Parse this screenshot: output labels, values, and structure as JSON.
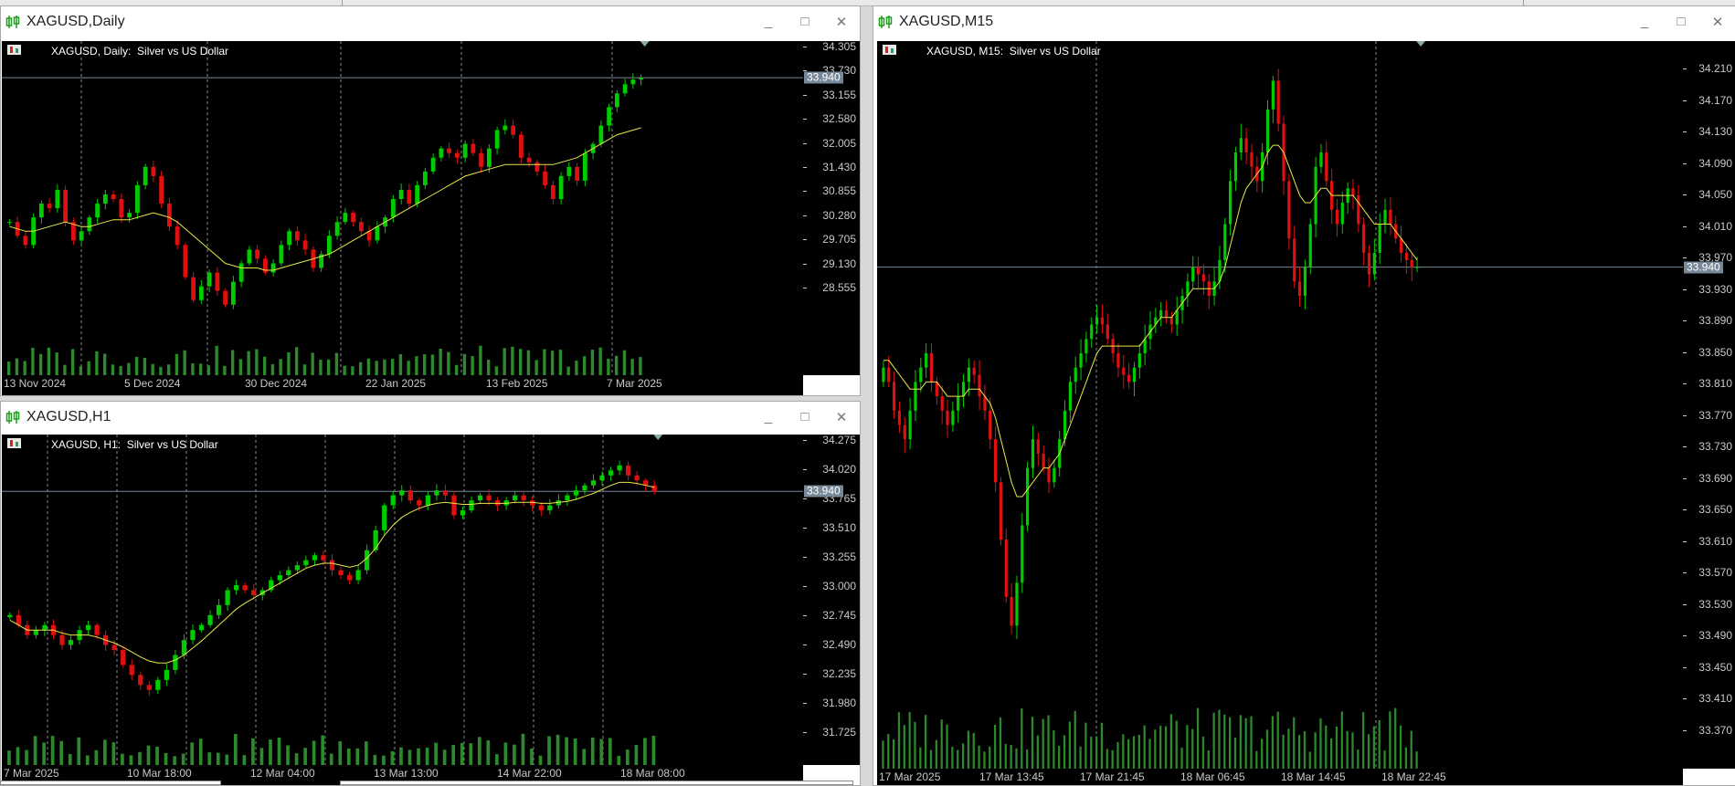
{
  "windows": {
    "daily": {
      "title": "XAGUSD,Daily",
      "chart_symbol": "XAGUSD, Daily:",
      "chart_desc": "Silver vs US Dollar",
      "current_price": "33.940",
      "price_labels": [
        "34.305",
        "33.730",
        "33.155",
        "32.580",
        "32.005",
        "31.430",
        "30.855",
        "30.280",
        "29.705",
        "29.130",
        "28.555"
      ],
      "time_labels": [
        "13 Nov 2024",
        "5 Dec 2024",
        "30 Dec 2024",
        "22 Jan 2025",
        "13 Feb 2025",
        "7 Mar 2025"
      ]
    },
    "h1": {
      "title": "XAGUSD,H1",
      "chart_symbol": "XAGUSD, H1:",
      "chart_desc": "Silver vs US Dollar",
      "current_price": "33.940",
      "price_labels": [
        "34.275",
        "34.020",
        "33.765",
        "33.510",
        "33.255",
        "33.000",
        "32.745",
        "32.490",
        "32.235",
        "31.980",
        "31.725"
      ],
      "time_labels": [
        "7 Mar 2025",
        "10 Mar 18:00",
        "12 Mar 04:00",
        "13 Mar 13:00",
        "14 Mar 22:00",
        "18 Mar 08:00"
      ]
    },
    "m15": {
      "title": "XAGUSD,M15",
      "chart_symbol": "XAGUSD, M15:",
      "chart_desc": "Silver vs US Dollar",
      "current_price": "33.940",
      "price_labels": [
        "34.210",
        "34.170",
        "34.130",
        "34.090",
        "34.050",
        "34.010",
        "33.970",
        "33.930",
        "33.890",
        "33.850",
        "33.810",
        "33.770",
        "33.730",
        "33.690",
        "33.650",
        "33.610",
        "33.570",
        "33.530",
        "33.490",
        "33.450",
        "33.410",
        "33.370"
      ],
      "time_labels": [
        "17 Mar 2025",
        "17 Mar 13:45",
        "17 Mar 21:45",
        "18 Mar 06:45",
        "18 Mar 14:45",
        "18 Mar 22:45"
      ]
    }
  },
  "window_controls": {
    "minimize": "_",
    "maximize": "□",
    "close": "✕"
  },
  "icons": {
    "window": "candlestick-app-icon",
    "chart_info": "chart-flag-icon"
  },
  "colors": {
    "bull_candle": "#00cc00",
    "bear_candle": "#e01010",
    "moving_average": "#e8e84a",
    "volume": "#2c8a2c",
    "grid": "#8a8a8a",
    "price_line": "#778899"
  },
  "chart_data": [
    {
      "type": "candlestick",
      "symbol": "XAGUSD",
      "timeframe": "Daily",
      "title": "XAGUSD, Daily:  Silver vs US Dollar",
      "ylim": [
        28.3,
        34.5
      ],
      "close": [
        30.8,
        30.5,
        30.3,
        30.9,
        31.2,
        31.1,
        31.5,
        30.8,
        30.4,
        30.6,
        30.9,
        31.2,
        31.4,
        31.3,
        30.9,
        31.0,
        31.6,
        32.0,
        31.8,
        31.2,
        30.7,
        30.3,
        29.6,
        29.1,
        29.4,
        29.7,
        29.3,
        29.0,
        29.5,
        29.9,
        30.2,
        30.0,
        29.7,
        29.9,
        30.3,
        30.6,
        30.4,
        30.2,
        29.8,
        30.1,
        30.5,
        30.8,
        31.0,
        30.8,
        30.6,
        30.4,
        30.7,
        30.9,
        31.3,
        31.5,
        31.2,
        31.6,
        31.9,
        32.2,
        32.4,
        32.3,
        32.2,
        32.5,
        32.3,
        32.0,
        32.4,
        32.8,
        32.9,
        32.7,
        32.2,
        32.1,
        31.9,
        31.6,
        31.3,
        31.8,
        32.0,
        31.7,
        32.3,
        32.5,
        32.9,
        33.3,
        33.6,
        33.8,
        33.9,
        33.94
      ],
      "moving_average": [
        30.7,
        30.65,
        30.6,
        30.6,
        30.65,
        30.7,
        30.75,
        30.8,
        30.75,
        30.7,
        30.7,
        30.75,
        30.8,
        30.85,
        30.85,
        30.85,
        30.9,
        30.95,
        31.0,
        30.95,
        30.9,
        30.8,
        30.65,
        30.5,
        30.35,
        30.2,
        30.05,
        29.9,
        29.85,
        29.8,
        29.8,
        29.8,
        29.75,
        29.75,
        29.8,
        29.85,
        29.9,
        29.95,
        30.0,
        30.05,
        30.1,
        30.2,
        30.3,
        30.4,
        30.5,
        30.6,
        30.7,
        30.8,
        30.9,
        31.0,
        31.1,
        31.2,
        31.3,
        31.4,
        31.5,
        31.6,
        31.7,
        31.8,
        31.85,
        31.9,
        31.95,
        32.0,
        32.05,
        32.05,
        32.05,
        32.05,
        32.05,
        32.05,
        32.05,
        32.1,
        32.15,
        32.2,
        32.3,
        32.4,
        32.5,
        32.6,
        32.7,
        32.75,
        32.8,
        32.85
      ]
    },
    {
      "type": "candlestick",
      "symbol": "XAGUSD",
      "timeframe": "H1",
      "title": "XAGUSD, H1:  Silver vs US Dollar",
      "ylim": [
        31.6,
        34.4
      ],
      "close": [
        32.7,
        32.6,
        32.5,
        32.55,
        32.6,
        32.5,
        32.4,
        32.45,
        32.55,
        32.6,
        32.5,
        32.4,
        32.35,
        32.2,
        32.1,
        32.0,
        31.95,
        32.05,
        32.15,
        32.3,
        32.45,
        32.55,
        32.6,
        32.7,
        32.8,
        32.95,
        33.0,
        32.95,
        32.9,
        32.95,
        33.05,
        33.1,
        33.15,
        33.2,
        33.25,
        33.3,
        33.25,
        33.15,
        33.1,
        33.05,
        33.15,
        33.35,
        33.55,
        33.8,
        33.9,
        33.95,
        33.85,
        33.8,
        33.9,
        33.95,
        33.9,
        33.7,
        33.75,
        33.85,
        33.9,
        33.85,
        33.8,
        33.85,
        33.9,
        33.85,
        33.8,
        33.75,
        33.8,
        33.85,
        33.9,
        33.95,
        34.0,
        34.05,
        34.1,
        34.15,
        34.2,
        34.1,
        34.05,
        34.0,
        33.94
      ],
      "moving_average": [
        32.65,
        32.6,
        32.55,
        32.55,
        32.55,
        32.55,
        32.52,
        32.5,
        32.5,
        32.5,
        32.48,
        32.45,
        32.42,
        32.38,
        32.33,
        32.28,
        32.24,
        32.22,
        32.22,
        32.25,
        32.3,
        32.37,
        32.44,
        32.52,
        32.6,
        32.68,
        32.76,
        32.82,
        32.87,
        32.92,
        32.97,
        33.02,
        33.07,
        33.12,
        33.17,
        33.2,
        33.22,
        33.22,
        33.2,
        33.18,
        33.2,
        33.27,
        33.37,
        33.5,
        33.6,
        33.68,
        33.73,
        33.77,
        33.8,
        33.82,
        33.83,
        33.82,
        33.81,
        33.81,
        33.82,
        33.82,
        33.82,
        33.82,
        33.83,
        33.83,
        33.83,
        33.82,
        33.82,
        33.83,
        33.84,
        33.86,
        33.89,
        33.92,
        33.96,
        34.0,
        34.03,
        34.03,
        34.02,
        34.0,
        33.98
      ]
    },
    {
      "type": "candlestick",
      "symbol": "XAGUSD",
      "timeframe": "M15",
      "title": "XAGUSD, M15:  Silver vs US Dollar",
      "ylim": [
        33.34,
        34.24
      ],
      "close": [
        33.8,
        33.78,
        33.74,
        33.72,
        33.7,
        33.74,
        33.78,
        33.8,
        33.82,
        33.78,
        33.76,
        33.74,
        33.72,
        33.74,
        33.76,
        33.78,
        33.8,
        33.79,
        33.76,
        33.74,
        33.7,
        33.64,
        33.56,
        33.48,
        33.44,
        33.5,
        33.58,
        33.66,
        33.7,
        33.68,
        33.66,
        33.64,
        33.66,
        33.7,
        33.74,
        33.78,
        33.8,
        33.82,
        33.84,
        33.86,
        33.87,
        33.86,
        33.84,
        33.82,
        33.8,
        33.79,
        33.78,
        33.8,
        33.82,
        33.84,
        33.86,
        33.87,
        33.88,
        33.87,
        33.86,
        33.88,
        33.9,
        33.92,
        33.94,
        33.93,
        33.92,
        33.9,
        33.92,
        33.95,
        34.0,
        34.06,
        34.1,
        34.12,
        34.1,
        34.08,
        34.06,
        34.1,
        34.16,
        34.2,
        34.14,
        34.06,
        33.98,
        33.92,
        33.9,
        33.94,
        34.0,
        34.08,
        34.1,
        34.06,
        34.02,
        34.0,
        34.03,
        34.05,
        34.04,
        34.0,
        33.96,
        33.93,
        33.96,
        34.0,
        34.02,
        34.0,
        33.98,
        33.96,
        33.95,
        33.94,
        33.94
      ],
      "moving_average": [
        33.81,
        33.81,
        33.8,
        33.79,
        33.78,
        33.77,
        33.77,
        33.77,
        33.78,
        33.78,
        33.78,
        33.77,
        33.76,
        33.76,
        33.76,
        33.76,
        33.77,
        33.77,
        33.77,
        33.76,
        33.75,
        33.73,
        33.7,
        33.67,
        33.64,
        33.62,
        33.62,
        33.63,
        33.64,
        33.65,
        33.66,
        33.66,
        33.67,
        33.68,
        33.7,
        33.72,
        33.74,
        33.76,
        33.78,
        33.8,
        33.82,
        33.83,
        33.83,
        33.83,
        33.83,
        33.83,
        33.83,
        33.83,
        33.83,
        33.84,
        33.85,
        33.86,
        33.87,
        33.87,
        33.87,
        33.88,
        33.89,
        33.9,
        33.91,
        33.91,
        33.91,
        33.91,
        33.91,
        33.92,
        33.94,
        33.97,
        34.0,
        34.03,
        34.05,
        34.06,
        34.07,
        34.08,
        34.1,
        34.11,
        34.11,
        34.1,
        34.08,
        34.06,
        34.04,
        34.03,
        34.03,
        34.04,
        34.05,
        34.05,
        34.04,
        34.04,
        34.04,
        34.04,
        34.04,
        34.03,
        34.02,
        34.01,
        34.0,
        34.0,
        34.0,
        34.0,
        33.99,
        33.98,
        33.97,
        33.96,
        33.95
      ]
    }
  ]
}
